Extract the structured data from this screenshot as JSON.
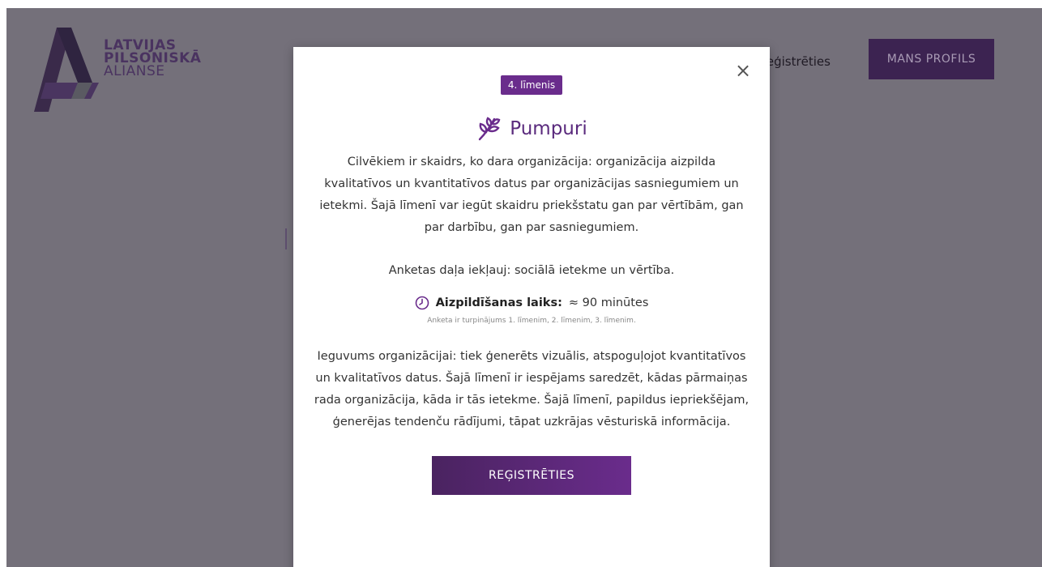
{
  "header": {
    "logo": {
      "line1": "LATVIJAS",
      "line2": "PILSONISKĀ",
      "line3": "ALIANSE"
    },
    "nav_link": "reģistrēties",
    "profile_button": "MANS PROFILS"
  },
  "modal": {
    "level_badge": "4. līmenis",
    "title": "Pumpuri",
    "title_icon": "leaf-sprout-icon",
    "description": "Cilvēkiem ir skaidrs, ko dara organizācija: organizācija aizpilda kvalitatīvos un kvantitatīvos datus par organizācijas sasniegumiem un ietekmi. Šajā līmenī var iegūt skaidru priekšstatu gan par vērtībām, gan par darbību, gan par sasniegumiem.",
    "includes": "Anketas daļa iekļauj: sociālā ietekme un vērtība.",
    "time_label": "Aizpildīšanas laiks:",
    "time_value": "≈ 90 minūtes",
    "note": "Anketa ir turpinājums 1. līmenim, 2. līmenim, 3. līmenim.",
    "result": "Ieguvums organizācijai: tiek ģenerēts vizuālis, atspoguļojot kvantitatīvos un kvalitatīvos datus. Šajā līmenī ir iespējams saredzēt, kādas pārmaiņas rada organizācija, kāda ir tās ietekme. Šajā līmenī, papildus iepriekšējam, ģenerējas tendenču rādījumi, tāpat uzkrājas vēsturiskā informācija.",
    "register_button": "REĢISTRĒTIES",
    "close_label": "×"
  },
  "colors": {
    "overlay": "#74707a",
    "accent": "#6a2c8c",
    "accent_dark": "#3c2351"
  }
}
